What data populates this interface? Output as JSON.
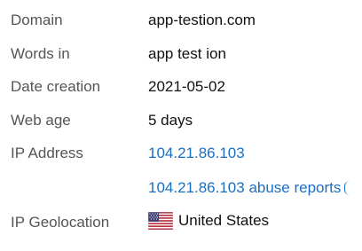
{
  "rows": {
    "domain": {
      "label": "Domain",
      "value": "app-testion.com"
    },
    "words": {
      "label": "Words in",
      "value": "app test ion"
    },
    "date": {
      "label": "Date creation",
      "value": "2021-05-02"
    },
    "age": {
      "label": "Web age",
      "value": "5 days"
    },
    "ip": {
      "label": "IP Address",
      "value": "104.21.86.103"
    },
    "abuse": {
      "value": "104.21.86.103 abuse reports"
    },
    "geo": {
      "label": "IP Geolocation",
      "country": "United States",
      "flag_icon": "us-flag-icon"
    }
  },
  "colors": {
    "label": "#555555",
    "value": "#111111",
    "link": "#1a6fc4"
  }
}
